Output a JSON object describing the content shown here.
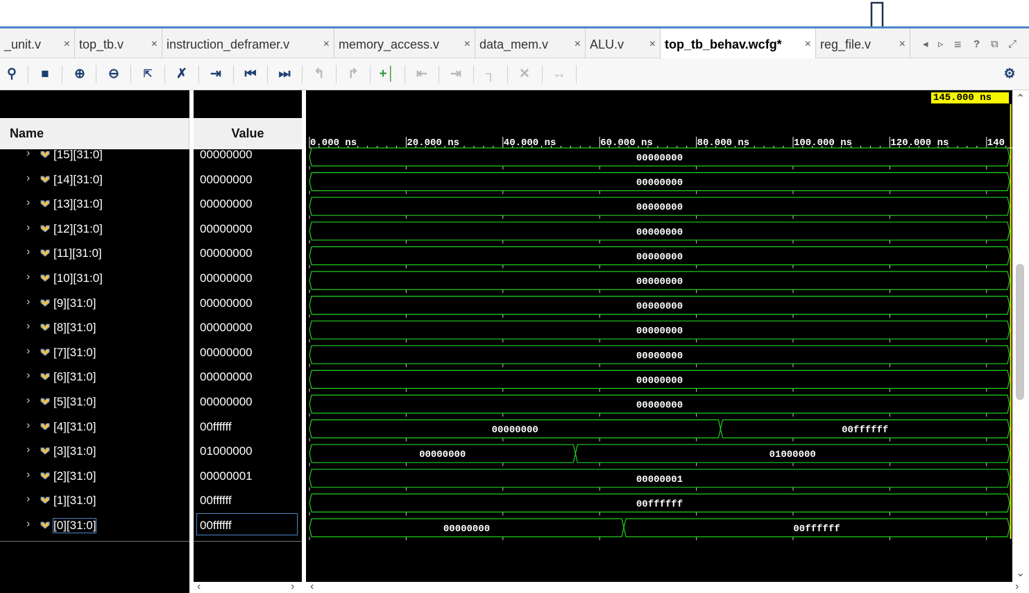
{
  "tabs": [
    {
      "label": "_unit.v",
      "active": false
    },
    {
      "label": "top_tb.v",
      "active": false
    },
    {
      "label": "instruction_deframer.v",
      "active": false
    },
    {
      "label": "memory_access.v",
      "active": false
    },
    {
      "label": "data_mem.v",
      "active": false
    },
    {
      "label": "ALU.v",
      "active": false
    },
    {
      "label": "top_tb_behav.wcfg*",
      "active": true
    },
    {
      "label": "reg_file.v",
      "active": false
    }
  ],
  "tab_close_glyph": "×",
  "tab_controls": [
    "◂",
    "▹",
    "≡",
    "?",
    "⧉",
    "⤢"
  ],
  "toolbar": {
    "icons": [
      "search-icon",
      "save-icon",
      "zoom-in-icon",
      "zoom-out-icon",
      "zoom-fit-icon",
      "cut-icon",
      "go-to-cursor-icon",
      "go-to-start-icon",
      "go-to-end-icon",
      "previous-transition-icon",
      "next-transition-icon",
      "add-marker-icon",
      "previous-marker-icon",
      "next-marker-icon",
      "delete-marker-icon",
      "delete-all-markers-icon",
      "swap-cursors-icon",
      "settings-icon"
    ]
  },
  "columns": {
    "name": "Name",
    "value": "Value"
  },
  "cursor": {
    "time": 145.0,
    "label": "145.000 ns"
  },
  "timeline": {
    "unit": "ns",
    "ticks": [
      {
        "t": 0,
        "label": "0.000 ns"
      },
      {
        "t": 20,
        "label": "20.000 ns"
      },
      {
        "t": 40,
        "label": "40.000 ns"
      },
      {
        "t": 60,
        "label": "60.000 ns"
      },
      {
        "t": 80,
        "label": "80.000 ns"
      },
      {
        "t": 100,
        "label": "100.000 ns"
      },
      {
        "t": 120,
        "label": "120.000 ns"
      },
      {
        "t": 140,
        "label": "140"
      }
    ]
  },
  "signals": [
    {
      "name": "[15][31:0]",
      "value": "00000000",
      "segments": [
        {
          "start": 0,
          "end": 145,
          "text": "00000000"
        }
      ]
    },
    {
      "name": "[14][31:0]",
      "value": "00000000",
      "segments": [
        {
          "start": 0,
          "end": 145,
          "text": "00000000"
        }
      ]
    },
    {
      "name": "[13][31:0]",
      "value": "00000000",
      "segments": [
        {
          "start": 0,
          "end": 145,
          "text": "00000000"
        }
      ]
    },
    {
      "name": "[12][31:0]",
      "value": "00000000",
      "segments": [
        {
          "start": 0,
          "end": 145,
          "text": "00000000"
        }
      ]
    },
    {
      "name": "[11][31:0]",
      "value": "00000000",
      "segments": [
        {
          "start": 0,
          "end": 145,
          "text": "00000000"
        }
      ]
    },
    {
      "name": "[10][31:0]",
      "value": "00000000",
      "segments": [
        {
          "start": 0,
          "end": 145,
          "text": "00000000"
        }
      ]
    },
    {
      "name": "[9][31:0]",
      "value": "00000000",
      "segments": [
        {
          "start": 0,
          "end": 145,
          "text": "00000000"
        }
      ]
    },
    {
      "name": "[8][31:0]",
      "value": "00000000",
      "segments": [
        {
          "start": 0,
          "end": 145,
          "text": "00000000"
        }
      ]
    },
    {
      "name": "[7][31:0]",
      "value": "00000000",
      "segments": [
        {
          "start": 0,
          "end": 145,
          "text": "00000000"
        }
      ]
    },
    {
      "name": "[6][31:0]",
      "value": "00000000",
      "segments": [
        {
          "start": 0,
          "end": 145,
          "text": "00000000"
        }
      ]
    },
    {
      "name": "[5][31:0]",
      "value": "00000000",
      "segments": [
        {
          "start": 0,
          "end": 145,
          "text": "00000000"
        }
      ]
    },
    {
      "name": "[4][31:0]",
      "value": "00ffffff",
      "segments": [
        {
          "start": 0,
          "end": 85,
          "text": "00000000"
        },
        {
          "start": 85,
          "end": 145,
          "text": "00ffffff"
        }
      ]
    },
    {
      "name": "[3][31:0]",
      "value": "01000000",
      "segments": [
        {
          "start": 0,
          "end": 55,
          "text": "00000000"
        },
        {
          "start": 55,
          "end": 145,
          "text": "01000000"
        }
      ]
    },
    {
      "name": "[2][31:0]",
      "value": "00000001",
      "segments": [
        {
          "start": 0,
          "end": 145,
          "text": "00000001"
        }
      ]
    },
    {
      "name": "[1][31:0]",
      "value": "00ffffff",
      "segments": [
        {
          "start": 0,
          "end": 145,
          "text": "00ffffff"
        }
      ]
    },
    {
      "name": "[0][31:0]",
      "value": "00ffffff",
      "selected": true,
      "segments": [
        {
          "start": 0,
          "end": 65,
          "text": "00000000"
        },
        {
          "start": 65,
          "end": 145,
          "text": "00ffffff"
        }
      ]
    }
  ],
  "colors": {
    "wave": "#1fd01f",
    "wave_text": "#ffffff",
    "cursor": "#f6f600",
    "background": "#000000",
    "accent": "#4a86c8"
  }
}
